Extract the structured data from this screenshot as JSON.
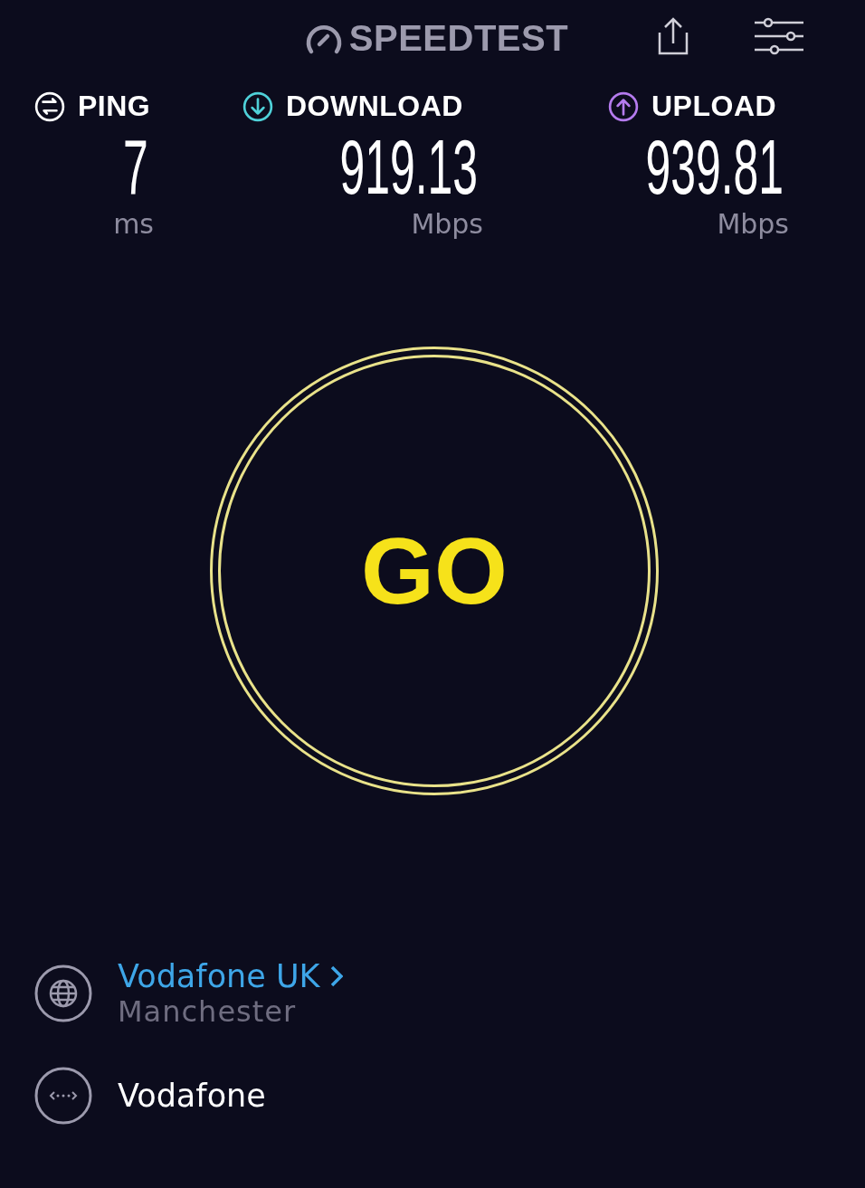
{
  "header": {
    "logo": "SPEEDTEST"
  },
  "metrics": [
    {
      "kind": "ping",
      "label": "PING",
      "value": "7",
      "unit": "ms",
      "color": "#ffffff"
    },
    {
      "kind": "download",
      "label": "DOWNLOAD",
      "value": "919.13",
      "unit": "Mbps",
      "color": "#4fd1d9"
    },
    {
      "kind": "upload",
      "label": "UPLOAD",
      "value": "939.81",
      "unit": "Mbps",
      "color": "#b57bee"
    }
  ],
  "go_button": {
    "label": "GO"
  },
  "connections": [
    {
      "kind": "isp",
      "name": "Vodafone UK",
      "location": "Manchester"
    },
    {
      "kind": "network",
      "name": "Vodafone"
    }
  ]
}
